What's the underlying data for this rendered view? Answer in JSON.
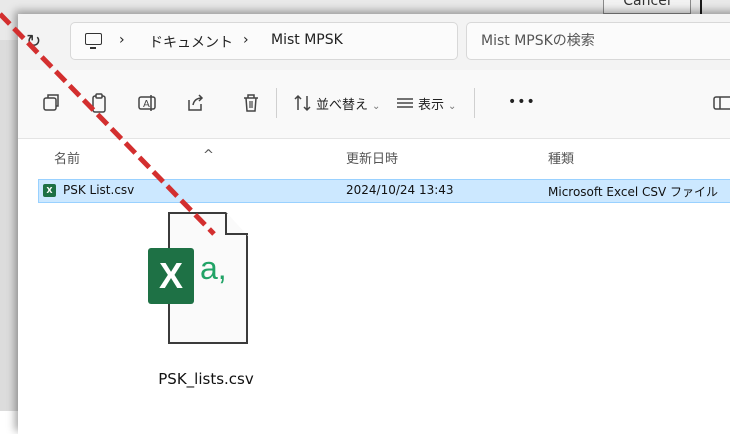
{
  "background": {
    "cancel_label": "Cancel"
  },
  "address_bar": {
    "separator": "›",
    "crumb_1": "ドキュメント",
    "crumb_2": "Mist MPSK",
    "search_placeholder": "Mist MPSKの検索"
  },
  "toolbar": {
    "sort_label": "並べ替え",
    "view_label": "表示",
    "more_label": "•••"
  },
  "columns": {
    "name": "名前",
    "modified": "更新日時",
    "type": "種類"
  },
  "files": [
    {
      "name": "PSK List.csv",
      "modified": "2024/10/24 13:43",
      "type": "Microsoft Excel CSV ファイル"
    }
  ],
  "dragged_file": {
    "label": "PSK_lists.csv",
    "badge": "X",
    "glyph": "a,"
  },
  "colors": {
    "selection": "#cce8ff",
    "excel_green": "#1e7145",
    "arrow_red": "#d32f2f"
  }
}
